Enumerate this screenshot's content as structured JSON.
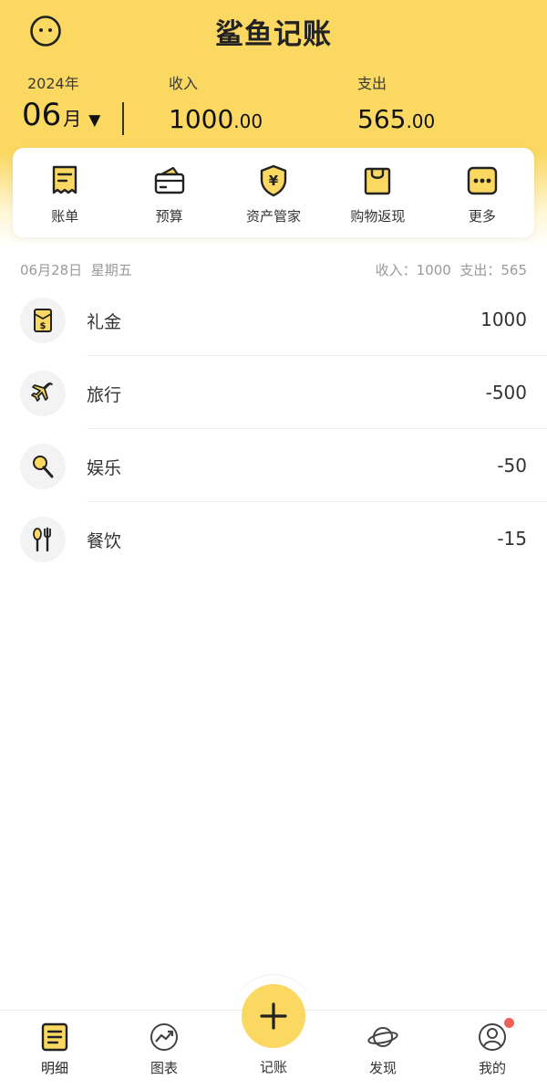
{
  "app": {
    "title": "鲨鱼记账"
  },
  "summary": {
    "year_label": "2024年",
    "month": "06",
    "month_unit": "月",
    "income_label": "收入",
    "income_int": "1000",
    "income_dec": ".00",
    "expense_label": "支出",
    "expense_int": "565",
    "expense_dec": ".00"
  },
  "quick_actions": [
    {
      "label": "账单",
      "icon": "receipt-icon"
    },
    {
      "label": "预算",
      "icon": "wallet-icon"
    },
    {
      "label": "资产管家",
      "icon": "yen-shield-icon"
    },
    {
      "label": "购物返现",
      "icon": "shopping-bag-icon"
    },
    {
      "label": "更多",
      "icon": "more-dots-icon"
    }
  ],
  "day": {
    "date": "06月28日",
    "weekday": "星期五",
    "totals": "收入：1000  支出：565"
  },
  "transactions": [
    {
      "category": "礼金",
      "amount": "1000",
      "icon": "red-envelope-icon"
    },
    {
      "category": "旅行",
      "amount": "-500",
      "icon": "airplane-icon"
    },
    {
      "category": "娱乐",
      "amount": "-50",
      "icon": "microphone-icon"
    },
    {
      "category": "餐饮",
      "amount": "-15",
      "icon": "utensils-icon"
    }
  ],
  "tabs": [
    {
      "label": "明细",
      "icon": "list-icon",
      "active": true
    },
    {
      "label": "图表",
      "icon": "chart-icon",
      "active": false
    },
    {
      "label": "记账",
      "icon": "plus-icon",
      "active": false
    },
    {
      "label": "发现",
      "icon": "planet-icon",
      "active": false
    },
    {
      "label": "我的",
      "icon": "user-icon",
      "active": false
    }
  ],
  "colors": {
    "accent": "#fad861",
    "badge": "#f0615a",
    "text": "#333333",
    "muted": "#9a9a9a"
  }
}
